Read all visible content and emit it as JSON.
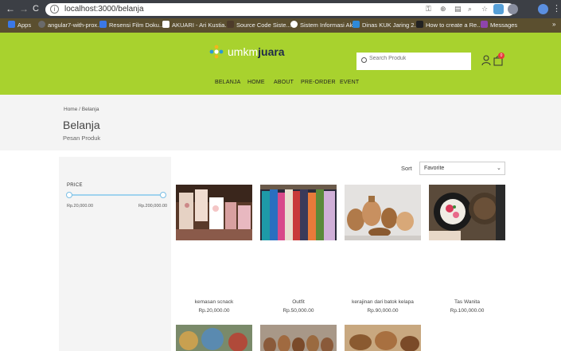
{
  "browser": {
    "url": "localhost:3000/belanja",
    "bookmarks": [
      {
        "label": "Apps",
        "color": "#3b78e7"
      },
      {
        "label": "angular7-with-prox...",
        "color": "#6a6a6a"
      },
      {
        "label": "Resensi Film Doku...",
        "color": "#3b78e7"
      },
      {
        "label": "AKUARI - Ari Kustia...",
        "color": "#ffffff"
      },
      {
        "label": "Source Code Siste...",
        "color": "#4d3b2a"
      },
      {
        "label": "Sistem Informasi Ak...",
        "color": "#ffffff"
      },
      {
        "label": "Dinas KUK Jaring 2...",
        "color": "#2e8ad8"
      },
      {
        "label": "How to create a Re...",
        "color": "#222222"
      },
      {
        "label": "Messages",
        "color": "#8e44ad"
      }
    ],
    "more": "»"
  },
  "header": {
    "logo_light": "umkm",
    "logo_bold": "juara",
    "search_placeholder": "Search Produk",
    "cart_count": "0",
    "nav": [
      "BELANJA",
      "HOME",
      "ABOUT",
      "PRE-ORDER",
      "EVENT"
    ]
  },
  "page": {
    "breadcrumb": "Home  /  Belanja",
    "title": "Belanja",
    "subtitle": "Pesan Produk"
  },
  "filter": {
    "price_label": "PRICE",
    "min_price": "Rp.20,000.00",
    "max_price": "Rp.200,000.00"
  },
  "sort": {
    "label": "Sort",
    "selected": "Favorite"
  },
  "products": [
    {
      "name": "kemasan scnack",
      "price": "Rp.20,000.00"
    },
    {
      "name": "Outfit",
      "price": "Rp.50,000.00"
    },
    {
      "name": "kerajinan dari batok kelapa",
      "price": "Rp.90,000.00"
    },
    {
      "name": "Tas Wanita",
      "price": "Rp.100,000.00"
    }
  ],
  "colors": {
    "brand_green": "#a8d22e",
    "logo_navy": "#1e2a4a",
    "slider_blue": "#9fd3ee",
    "badge_red": "#e8373c"
  }
}
